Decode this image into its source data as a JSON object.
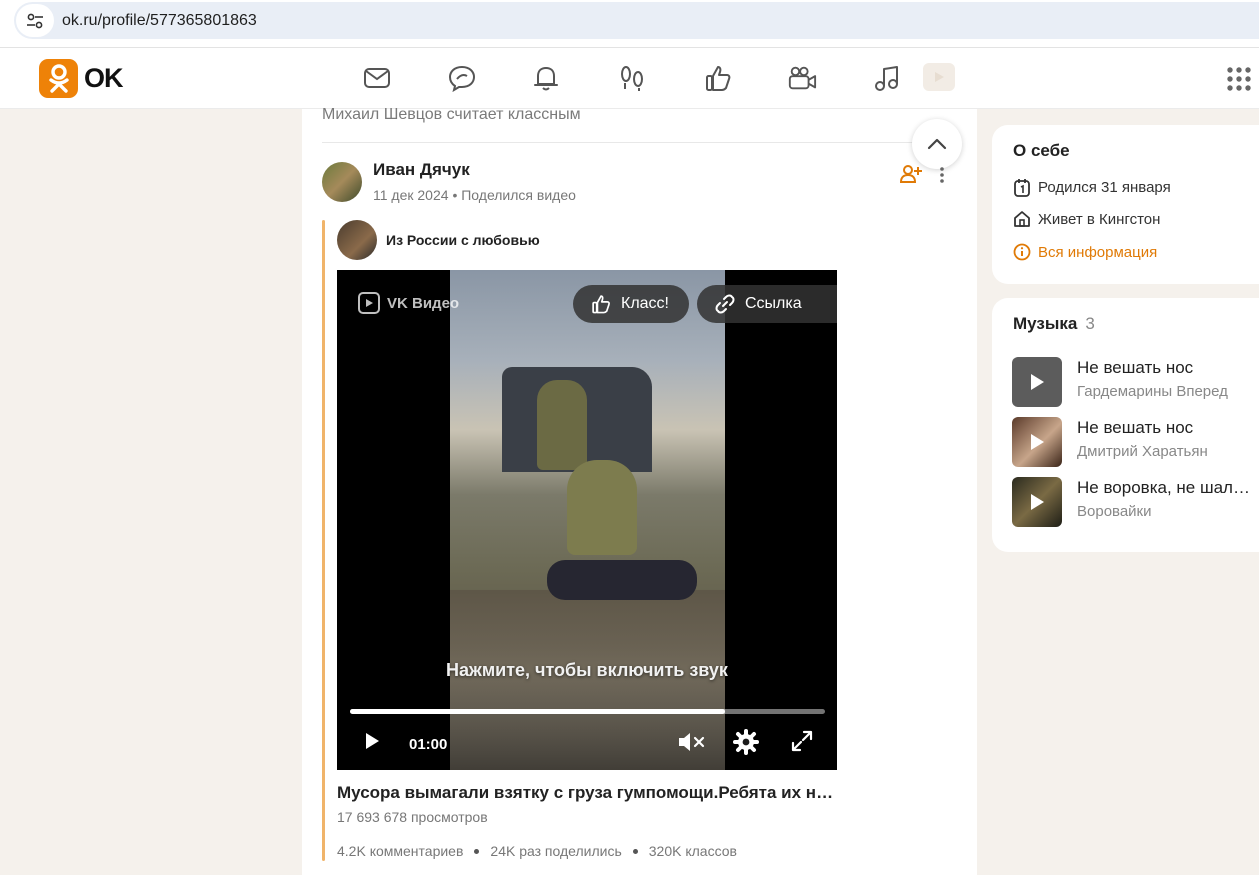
{
  "browser": {
    "url": "ok.ru/profile/577365801863"
  },
  "header": {
    "logo_text": "OK",
    "nav_icons": [
      "mail-icon",
      "chat-icon",
      "bell-icon",
      "footprints-icon",
      "thumbs-up-icon",
      "video-camera-icon",
      "music-note-icon",
      "video-play-icon",
      "apps-grid-icon"
    ]
  },
  "feed": {
    "previous_item_text": "Михаил Шевцов считает классным",
    "post": {
      "author": "Иван Дячук",
      "date": "11 дек 2024",
      "separator": "•",
      "action": "Поделился видео",
      "group_name": "Из России с любовью",
      "video": {
        "brand": "VK Видео",
        "class_button": "Класс!",
        "link_button": "Ссылка",
        "unmute_hint": "Нажмите, чтобы включить звук",
        "time": "01:00",
        "progress_fraction": 0.79
      },
      "title": "Мусора вымагали взятку с груза гумпомощи.Ребята их наказали",
      "views": "17 693 678 просмотров",
      "stats": {
        "comments": "4.2K комментариев",
        "shares": "24K раз поделились",
        "likes": "320K классов"
      }
    }
  },
  "about": {
    "title": "О себе",
    "birthday": "Родился 31 января",
    "location": "Живет в Кингстон",
    "more_link": "Вся информация"
  },
  "music": {
    "title": "Музыка",
    "count": "3",
    "tracks": [
      {
        "title": "Не вешать нос",
        "artist": "Гардемарины Вперед"
      },
      {
        "title": "Не вешать нос",
        "artist": "Дмитрий Харатьян"
      },
      {
        "title": "Не воровка, не шалава",
        "artist": "Воровайки"
      }
    ]
  },
  "colors": {
    "brand_orange": "#ee8208",
    "link_orange": "#e07a06",
    "page_bg": "#f5f1ec"
  }
}
